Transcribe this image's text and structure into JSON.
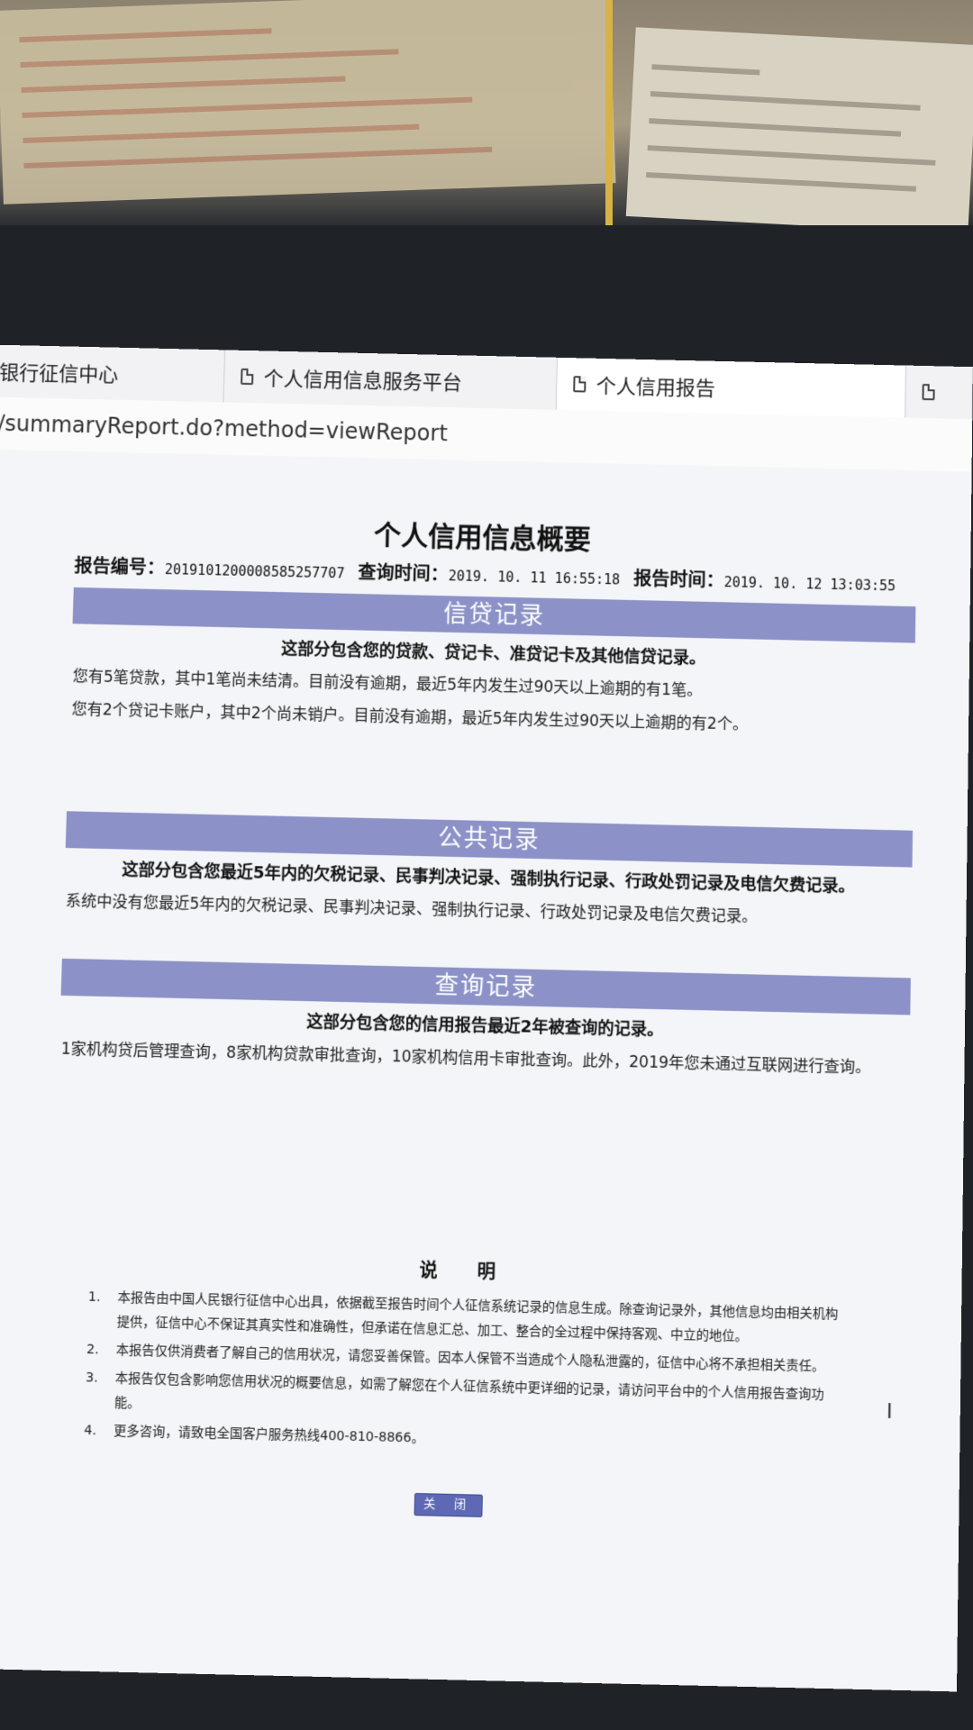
{
  "browser": {
    "tabs": [
      {
        "label": "银行征信中心"
      },
      {
        "label": "个人信用信息服务平台"
      },
      {
        "label": "个人信用报告"
      }
    ],
    "address": "/summaryReport.do?method=viewReport"
  },
  "report": {
    "title": "个人信用信息概要",
    "report_no_label": "报告编号：",
    "report_no": "2019101200008585257707",
    "query_time_label": "查询时间：",
    "query_time": "2019. 10. 11  16:55:18",
    "report_time_label": "报告时间：",
    "report_time": "2019. 10. 12  13:03:55"
  },
  "sections": {
    "credit": {
      "title": "信贷记录",
      "desc": "这部分包含您的贷款、贷记卡、准贷记卡及其他信贷记录。",
      "lines": [
        "您有5笔贷款，其中1笔尚未结清。目前没有逾期，最近5年内发生过90天以上逾期的有1笔。",
        "您有2个贷记卡账户，其中2个尚未销户。目前没有逾期，最近5年内发生过90天以上逾期的有2个。"
      ]
    },
    "public": {
      "title": "公共记录",
      "desc": "这部分包含您最近5年内的欠税记录、民事判决记录、强制执行记录、行政处罚记录及电信欠费记录。",
      "lines": [
        "系统中没有您最近5年内的欠税记录、民事判决记录、强制执行记录、行政处罚记录及电信欠费记录。"
      ]
    },
    "query": {
      "title": "查询记录",
      "desc": "这部分包含您的信用报告最近2年被查询的记录。",
      "lines": [
        "1家机构贷后管理查询，8家机构贷款审批查询，10家机构信用卡审批查询。此外，2019年您未通过互联网进行查询。"
      ]
    }
  },
  "notes": {
    "title": "说 明",
    "items": [
      {
        "num": "1.",
        "text": "本报告由中国人民银行征信中心出具，依据截至报告时间个人征信系统记录的信息生成。除查询记录外，其他信息均由相关机构提供，征信中心不保证其真实性和准确性，但承诺在信息汇总、加工、整合的全过程中保持客观、中立的地位。"
      },
      {
        "num": "2.",
        "text": "本报告仅供消费者了解自己的信用状况，请您妥善保管。因本人保管不当造成个人隐私泄露的，征信中心将不承担相关责任。"
      },
      {
        "num": "3.",
        "text": "本报告仅包含影响您信用状况的概要信息，如需了解您在个人征信系统中更详细的记录，请访问平台中的个人信用报告查询功能。"
      },
      {
        "num": "4.",
        "text": "更多咨询，请致电全国客户服务热线400-810-8866。"
      }
    ]
  },
  "close_button": "关 闭",
  "cursor_glyph": "I",
  "icons": {
    "tab_icon": "document-icon",
    "cursor": "text-cursor-icon"
  }
}
